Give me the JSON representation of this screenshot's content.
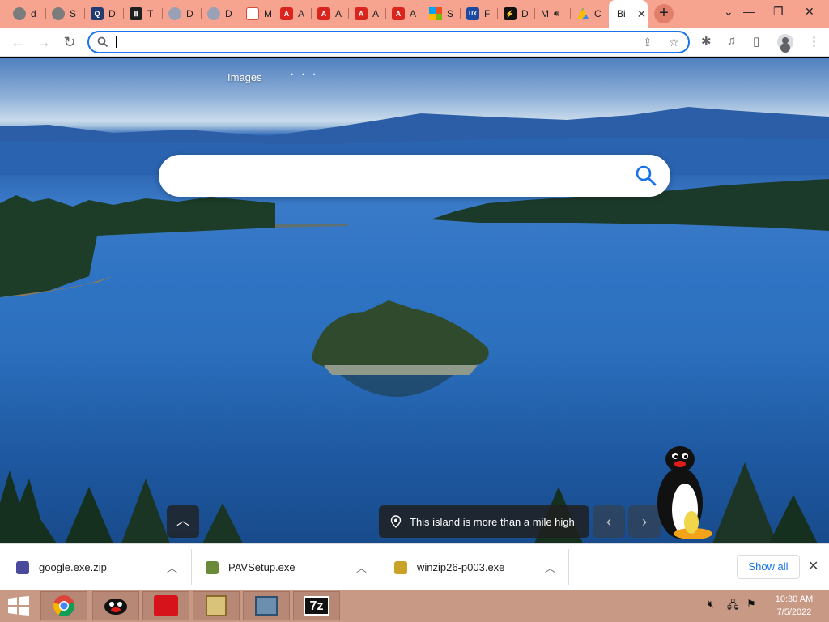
{
  "tabs": [
    {
      "label": "d",
      "icon": "globe-icon"
    },
    {
      "label": "S",
      "icon": "globe-icon"
    },
    {
      "label": "D",
      "icon": "q-icon"
    },
    {
      "label": "T",
      "icon": "bank-icon"
    },
    {
      "label": "D",
      "icon": "discord-icon"
    },
    {
      "label": "D",
      "icon": "discord-icon"
    },
    {
      "label": "M",
      "icon": "mail-icon"
    },
    {
      "label": "A",
      "icon": "adobe-icon"
    },
    {
      "label": "A",
      "icon": "adobe-icon"
    },
    {
      "label": "A",
      "icon": "adobe-icon"
    },
    {
      "label": "A",
      "icon": "adobe-icon"
    },
    {
      "label": "S",
      "icon": "microsoft-icon"
    },
    {
      "label": "F",
      "icon": "ux-icon"
    },
    {
      "label": "D",
      "icon": "bolt-icon"
    },
    {
      "label": "M",
      "icon": "speaker-icon"
    },
    {
      "label": "C",
      "icon": "drive-icon"
    }
  ],
  "active_tab": {
    "label": "Bi",
    "close": "✕"
  },
  "new_tab_label": "+",
  "window_controls": {
    "dropdown": "⌄",
    "minimize": "—",
    "restore": "❐",
    "close": "✕"
  },
  "toolbar": {
    "back": "←",
    "forward": "→",
    "reload": "↻",
    "url_value": "",
    "share": "⇪",
    "star": "☆",
    "extensions": "✱",
    "media": "♫",
    "sidepanel": "▯",
    "menu": "⋮"
  },
  "page": {
    "images_link": "Images",
    "more_dots": "· · ·",
    "search_value": "",
    "up_button": "︿",
    "caption": "This island is more than a mile high",
    "prev_arrow": "‹",
    "next_arrow": "›"
  },
  "downloads": [
    {
      "name": "google.exe.zip",
      "color": "#4a4a9c"
    },
    {
      "name": "PAVSetup.exe",
      "color": "#6a8a3a"
    },
    {
      "name": "winzip26-p003.exe",
      "color": "#c9a227"
    }
  ],
  "downloads_chevron": "︿",
  "show_all": "Show all",
  "downloads_close": "✕",
  "taskbar": {
    "sevenzip_label": "7z",
    "time": "10:30 AM",
    "date": "7/5/2022"
  },
  "colors": {
    "tabstrip": "#f6a48f",
    "taskbar": "#c89a86",
    "accent": "#1a73e8"
  }
}
